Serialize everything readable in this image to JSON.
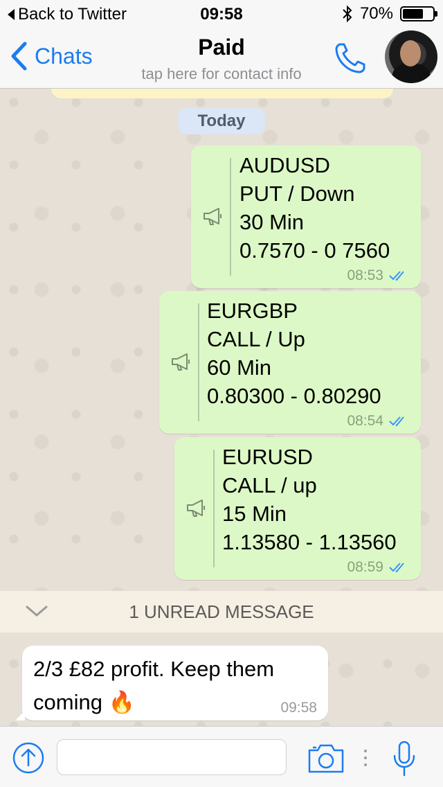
{
  "status_bar": {
    "back_label": "Back to Twitter",
    "time": "09:58",
    "battery": "70%",
    "battery_level": 0.7
  },
  "nav": {
    "back_label": "Chats",
    "title": "Paid",
    "subtitle": "tap here for contact info"
  },
  "chat": {
    "date_label": "Today",
    "messages_out": [
      {
        "lines": [
          "AUDUSD",
          "PUT / Down",
          "30 Min",
          "0.7570 - 0 7560"
        ],
        "time": "08:53"
      },
      {
        "lines": [
          "EURGBP",
          "CALL / Up",
          "60 Min",
          "0.80300 - 0.80290"
        ],
        "time": "08:54"
      },
      {
        "lines": [
          "EURUSD",
          "CALL / up",
          "15 Min",
          "1.13580 - 1.13560"
        ],
        "time": "08:59"
      }
    ],
    "unread_label": "1 UNREAD MESSAGE",
    "message_in": {
      "line1": "2/3 £82 profit. Keep them",
      "line2": "coming",
      "emoji": "🔥",
      "time": "09:58"
    }
  },
  "colors": {
    "accent": "#1b7cf0",
    "outgoing_bubble": "#dcf8c6",
    "incoming_bubble": "#ffffff",
    "read_ticks": "#3497f9"
  }
}
